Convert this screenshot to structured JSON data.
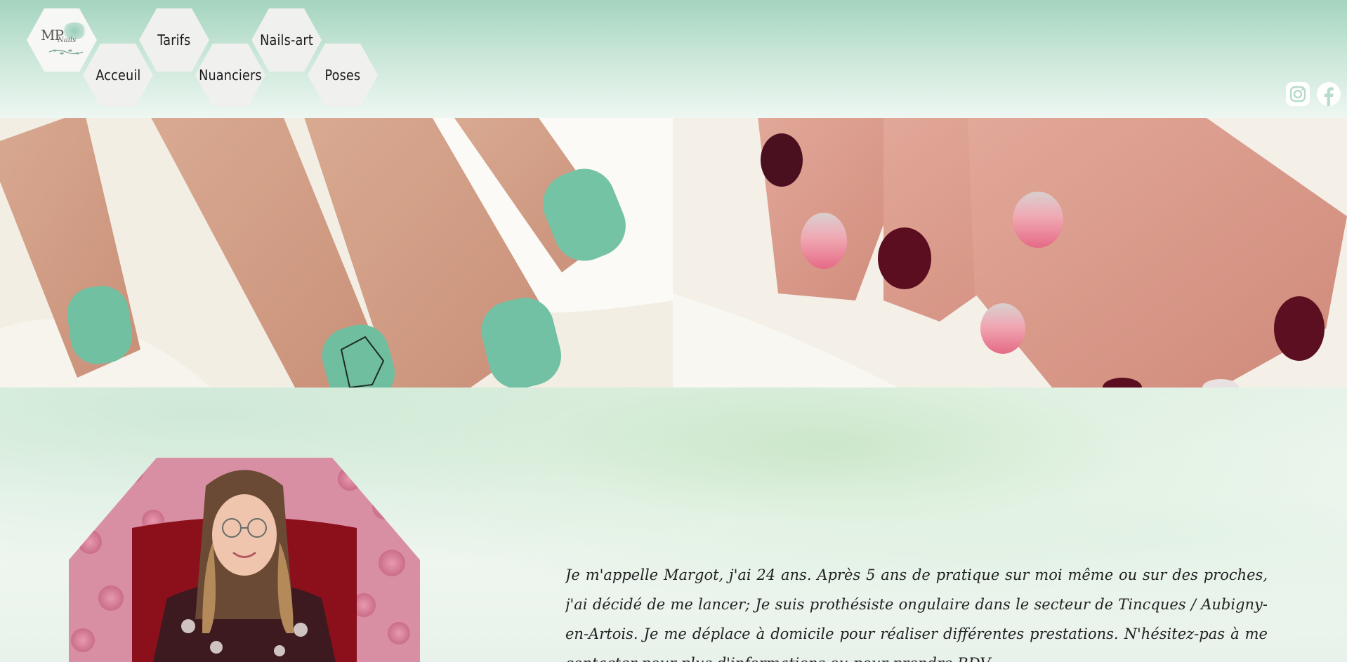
{
  "nav": {
    "logo_text_main": "MP",
    "logo_text_sub": "Nails",
    "items": [
      {
        "label": "Tarifs"
      },
      {
        "label": "Nails-art"
      },
      {
        "label": "Acceuil"
      },
      {
        "label": "Nuanciers"
      },
      {
        "label": "Poses"
      }
    ]
  },
  "social": {
    "instagram_icon": "instagram-icon",
    "facebook_icon": "facebook-icon"
  },
  "gallery": {
    "slides_shown": 2,
    "dots_total": 3,
    "active_dot": 3
  },
  "about": {
    "bio": "Je m'appelle Margot, j'ai 24 ans. Après 5 ans de pratique sur moi même ou sur des proches, j'ai décidé de me lancer; Je suis prothésiste ongulaire dans le secteur de Tincques / Aubigny-en-Artois. Je me déplace à domicile pour réaliser différentes prestations. N'hésitez-pas à me contacter pour plus d'informations ou pour prendre RDV."
  },
  "colors": {
    "header_green": "#a4d4bf",
    "accent_dot": "#c2413b"
  }
}
